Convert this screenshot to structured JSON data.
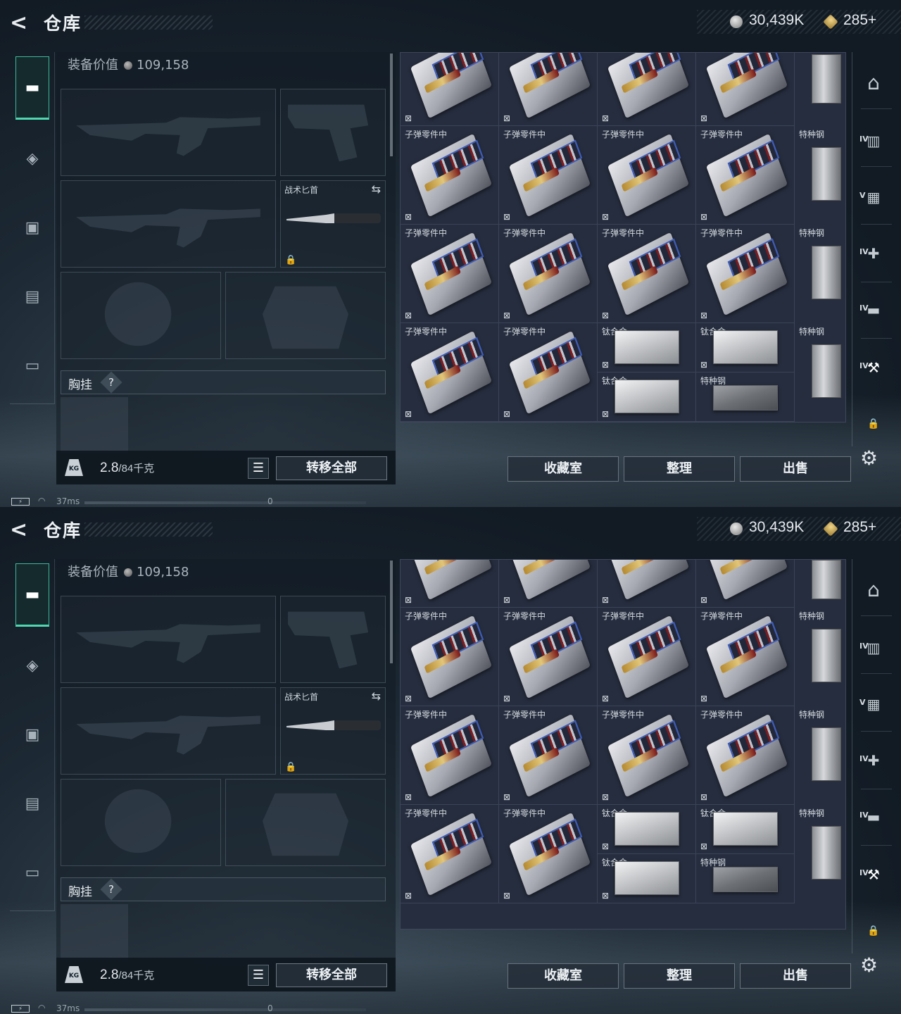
{
  "app": {
    "title": "仓库",
    "back_icon": "back-arrow-icon",
    "silver_balance": "30,439K",
    "gold_balance": "285+"
  },
  "equipment": {
    "value_label": "装备价值",
    "value": "109,158",
    "knife_label": "战术匕首",
    "chest_label": "胸挂",
    "help_glyph": "?",
    "weight_value": "2.8",
    "weight_capacity": "/84千克",
    "kg_badge": "KG",
    "transfer_all_label": "转移全部"
  },
  "left_rail": {
    "items": [
      {
        "icon": "pistol-icon",
        "glyph": "⌐",
        "active": true
      },
      {
        "icon": "armor-vest-icon",
        "glyph": "◈",
        "active": false
      },
      {
        "icon": "backpack-icon",
        "glyph": "▣",
        "active": false
      },
      {
        "icon": "rig-icon",
        "glyph": "▤",
        "active": false
      },
      {
        "icon": "medkit-case-icon",
        "glyph": "▭",
        "active": false
      }
    ]
  },
  "storage": {
    "ammo_parts_label": "子弹零件中",
    "titanium_label": "钛合金",
    "special_steel_label": "特种钢",
    "flag_glyph": "⊠"
  },
  "right_rail": {
    "items": [
      {
        "icon": "arch-gate-icon",
        "level": ""
      },
      {
        "icon": "storage-crate-icon",
        "level": "IV"
      },
      {
        "icon": "safe-camera-icon",
        "level": "V"
      },
      {
        "icon": "medical-case-icon",
        "level": "IV"
      },
      {
        "icon": "workbench-icon",
        "level": "IV"
      },
      {
        "icon": "crafting-station-icon",
        "level": "IV"
      }
    ],
    "lock_glyph": "🔒",
    "settings_glyph": "⚙"
  },
  "actions": {
    "collection_label": "收藏室",
    "sort_label": "整理",
    "sell_label": "出售"
  },
  "status": {
    "battery_glyph": "⚡",
    "wifi_glyph": "◠",
    "ping": "37ms",
    "counter": "0"
  }
}
